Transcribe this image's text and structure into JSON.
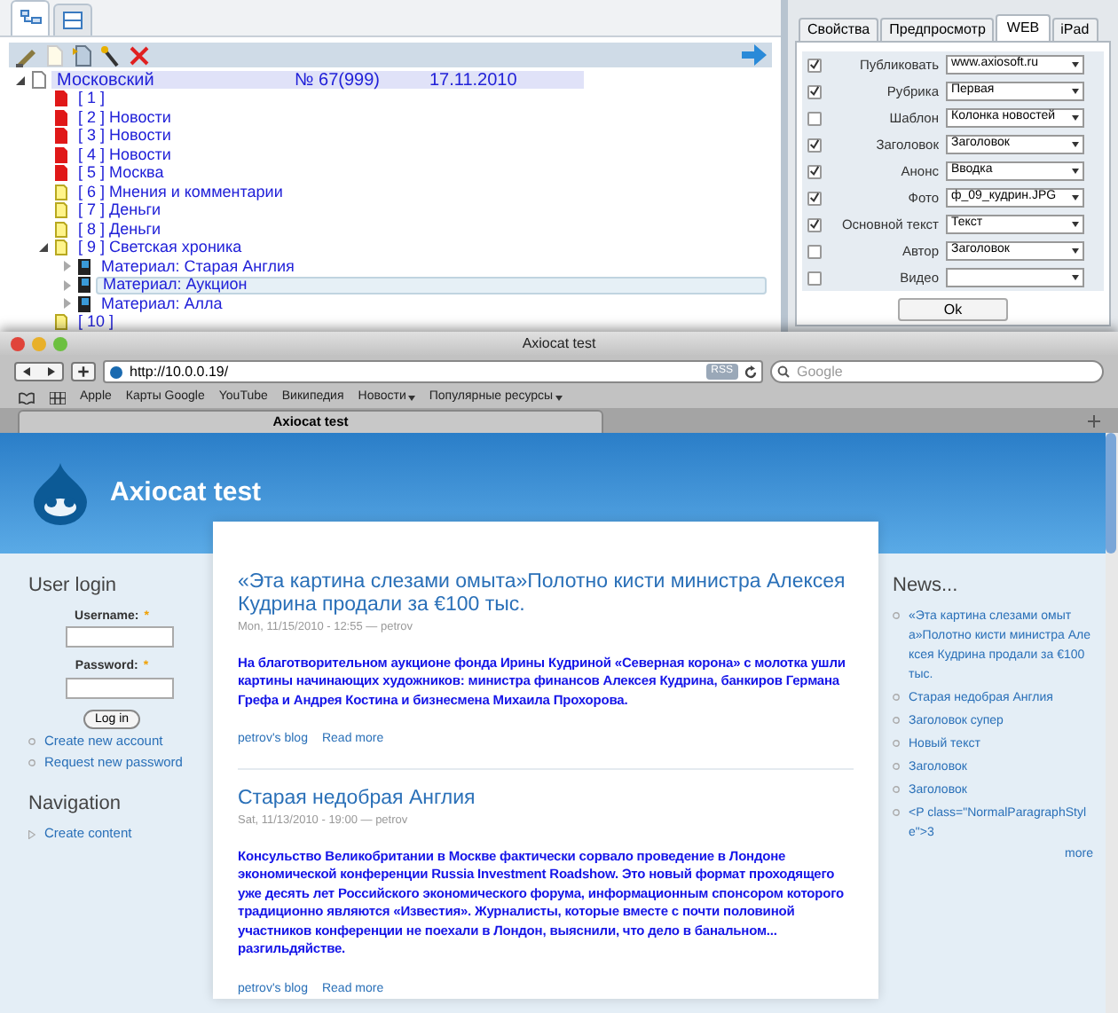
{
  "editor": {
    "view_tabs": [
      {
        "kind": "tree",
        "selected": true
      },
      {
        "kind": "list",
        "selected": false
      }
    ],
    "tree": [
      {
        "kind": "document",
        "label": "Московский",
        "issue": "№ 67(999)",
        "date": "17.11.2010",
        "expanded": true,
        "selected": false,
        "children": [
          {
            "kind": "red",
            "label": "[ 1 ]",
            "selected": false
          },
          {
            "kind": "red",
            "label": "[ 2 ] Новости",
            "selected": false
          },
          {
            "kind": "red",
            "label": "[ 3 ] Новости",
            "selected": false
          },
          {
            "kind": "red",
            "label": "[ 4 ] Новости",
            "selected": false
          },
          {
            "kind": "red",
            "label": "[ 5 ] Москва",
            "selected": false
          },
          {
            "kind": "yellow",
            "label": "[ 6 ] Мнения и комментарии",
            "selected": false
          },
          {
            "kind": "yellow",
            "label": "[ 7 ] Деньги",
            "selected": false
          },
          {
            "kind": "yellow",
            "label": "[ 8 ] Деньги",
            "selected": false
          },
          {
            "kind": "yellow",
            "label": "[ 9 ] Светская хроника",
            "expanded": true,
            "selected": false,
            "children": [
              {
                "kind": "material",
                "label": "Материал: Старая Англия",
                "expanded": false,
                "selected": false
              },
              {
                "kind": "material",
                "label": "Материал: Аукцион",
                "expanded": false,
                "selected": true
              },
              {
                "kind": "material",
                "label": "Материал: Алла",
                "expanded": false,
                "selected": false
              }
            ]
          },
          {
            "kind": "yellow",
            "label": "[ 10 ]",
            "selected": false
          }
        ]
      }
    ]
  },
  "properties": {
    "tabs": [
      {
        "label": "Свойства",
        "selected": false
      },
      {
        "label": "Предпросмотр",
        "selected": false
      },
      {
        "label": "WEB",
        "selected": true
      },
      {
        "label": "iPad",
        "selected": false
      }
    ],
    "rows": [
      {
        "label": "Публиковать",
        "checked": true,
        "value": "www.axiosoft.ru"
      },
      {
        "label": "Рубрика",
        "checked": true,
        "value": "Первая"
      },
      {
        "label": "Шаблон",
        "checked": false,
        "value": "Колонка новостей"
      },
      {
        "label": "Заголовок",
        "checked": true,
        "value": "Заголовок"
      },
      {
        "label": "Анонс",
        "checked": true,
        "value": "Вводка"
      },
      {
        "label": "Фото",
        "checked": true,
        "value": "ф_09_кудрин.JPG"
      },
      {
        "label": "Основной текст",
        "checked": true,
        "value": "Текст"
      },
      {
        "label": "Автор",
        "checked": false,
        "value": "Заголовок"
      },
      {
        "label": "Видео",
        "checked": false
      }
    ],
    "ok_button": "Ok"
  },
  "browser": {
    "title": "Axiocat test",
    "url": "http://10.0.0.19/",
    "rss": "RSS",
    "search": {
      "placeholder": "Google"
    },
    "bookmarks": [
      {
        "label": "Apple",
        "menu": false
      },
      {
        "label": "Карты Google",
        "menu": false
      },
      {
        "label": "YouTube",
        "menu": false
      },
      {
        "label": "Википедия",
        "menu": false
      },
      {
        "label": "Новости",
        "menu": true
      },
      {
        "label": "Популярные ресурсы",
        "menu": true
      }
    ],
    "tabs": [
      {
        "label": "Axiocat test",
        "selected": true
      }
    ]
  },
  "site": {
    "name": "Axiocat test",
    "login": {
      "title": "User login",
      "username_label": "Username:",
      "password_label": "Password:",
      "required": "*",
      "button": "Log in",
      "links": [
        "Create new account",
        "Request new password"
      ]
    },
    "navigation": {
      "title": "Navigation",
      "links": [
        "Create content"
      ]
    },
    "posts": [
      {
        "title": "«Эта картина слезами омыта»Полотно кисти министра Алексея Кудрина продали за €100 тыс.",
        "meta": "Mon, 11/15/2010 - 12:55 — petrov",
        "body": "На благотворительном аукционе фонда Ирины Кудриной «Северная корона» с молотка ушли картины начинающих художников: министра финансов Алексея Кудрина, банкиров Германа Грефа и Андрея Костина и бизнесмена Михаила Прохорова.",
        "links": [
          "petrov's blog",
          "Read more"
        ]
      },
      {
        "title": "Старая недобрая Англия",
        "meta": "Sat, 11/13/2010 - 19:00 — petrov",
        "body": "Консульство Великобритании в Москве фактически сорвало проведение в Лондоне экономической конференции Russia Investment Roadshow. Это новый формат проходящего уже десять лет Российского экономического форума, информационным спонсором которого традиционно являются «Известия». Журналисты, которые вместе с почти половиной участников конференции не поехали в Лондон, выяснили, что дело в банальном... разгильдяйстве.",
        "links": [
          "petrov's blog",
          "Read more"
        ]
      }
    ],
    "news": {
      "title": "News...",
      "items": [
        "«Эта картина слезами омыта»Полотно кисти министра Алексея Кудрина продали за €100 тыс.",
        "Старая недобрая Англия",
        "Заголовок супер",
        "Новый текст",
        "Заголовок",
        "Заголовок",
        "<P class=\"NormalParagraphStyle\">3"
      ],
      "more": "more"
    }
  }
}
